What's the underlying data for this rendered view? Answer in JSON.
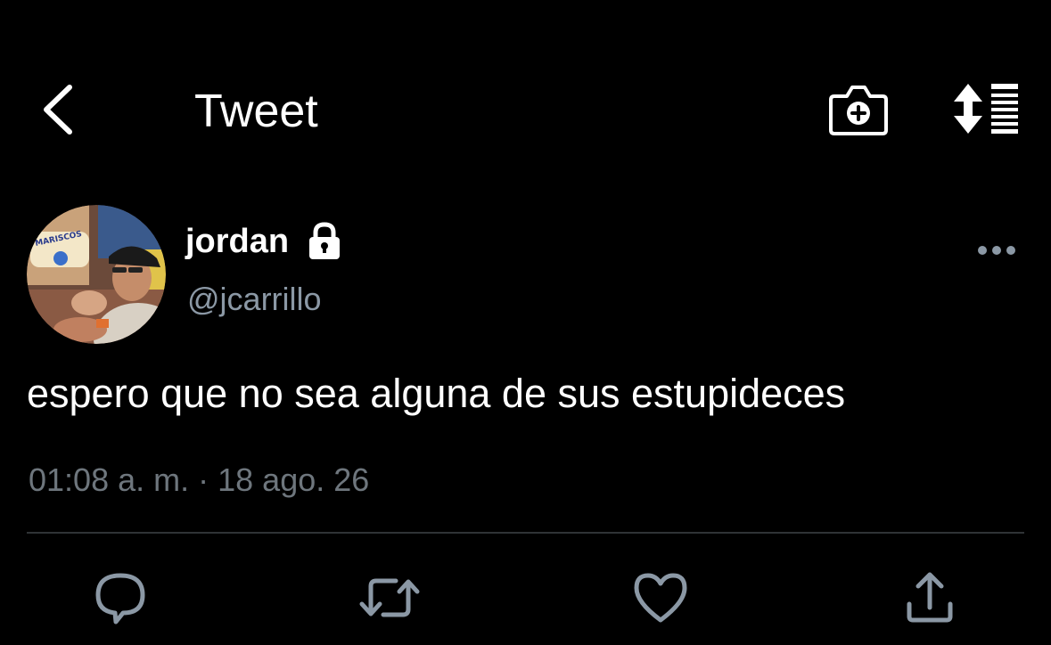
{
  "header": {
    "title": "Tweet",
    "icons": {
      "back": "chevron-left-icon",
      "camera": "camera-plus-icon",
      "sort": "sort-timeline-icon"
    }
  },
  "author": {
    "name": "jordan",
    "handle": "@jcarrillo",
    "protected_icon": "lock-icon",
    "avatar_sign_text": "MARISCOS"
  },
  "tweet": {
    "text": "espero que no sea alguna de sus estupideces",
    "time": "01:08 a. m.",
    "separator": "·",
    "date": "18 ago. 26"
  },
  "actions": {
    "icons": [
      "reply-icon",
      "retweet-icon",
      "like-icon",
      "share-icon"
    ]
  },
  "colors": {
    "background": "#000000",
    "primary_text": "#ffffff",
    "secondary_text": "#8b98a5",
    "meta_text": "#6e767d",
    "divider": "#2f3336",
    "action_icon": "#8b98a5"
  }
}
